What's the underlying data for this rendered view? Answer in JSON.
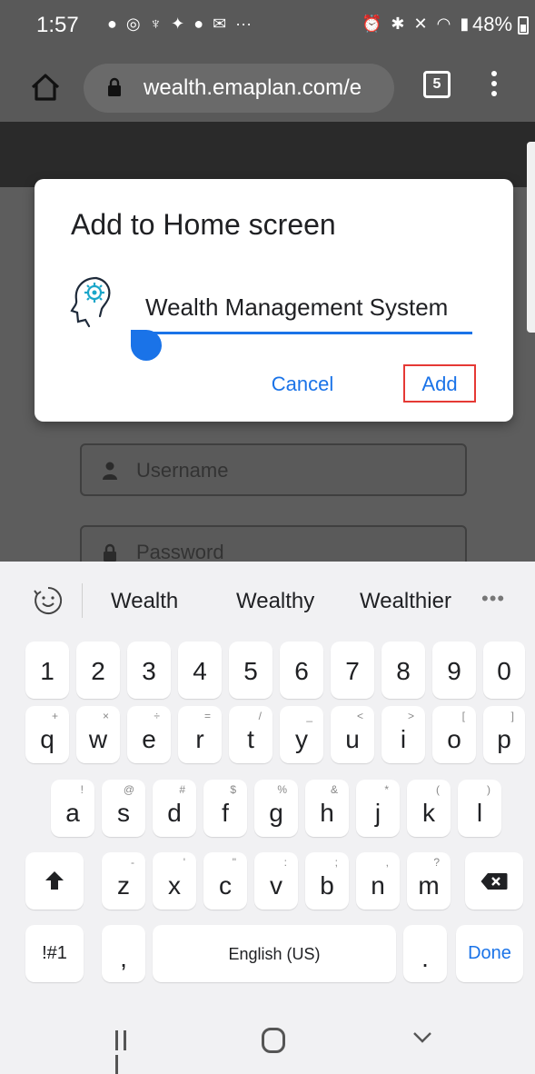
{
  "status_bar": {
    "time": "1:57",
    "battery": "48%",
    "notification_icons": [
      "spotify-icon",
      "instagram-icon",
      "app-icon",
      "app-icon",
      "facebook-icon",
      "gmail-icon",
      "more-icon"
    ],
    "system_icons": [
      "alarm-icon",
      "bluetooth-icon",
      "mute-icon",
      "wifi-icon",
      "signal-icon"
    ]
  },
  "browser": {
    "url": "wealth.emaplan.com/e",
    "tab_count": "5"
  },
  "page": {
    "username_placeholder": "Username",
    "password_placeholder": "Password"
  },
  "dialog": {
    "title": "Add to Home screen",
    "app_name": "Wealth Management System",
    "cancel_label": "Cancel",
    "add_label": "Add",
    "accent_color": "#1a73e8",
    "highlight_color": "#e53935"
  },
  "keyboard": {
    "suggestions": [
      "Wealth",
      "Wealthy",
      "Wealthier"
    ],
    "more_label": "•••",
    "number_row": [
      "1",
      "2",
      "3",
      "4",
      "5",
      "6",
      "7",
      "8",
      "9",
      "0"
    ],
    "row1": [
      {
        "k": "q",
        "s": "+"
      },
      {
        "k": "w",
        "s": "×"
      },
      {
        "k": "e",
        "s": "÷"
      },
      {
        "k": "r",
        "s": "="
      },
      {
        "k": "t",
        "s": "/"
      },
      {
        "k": "y",
        "s": "_"
      },
      {
        "k": "u",
        "s": "<"
      },
      {
        "k": "i",
        "s": ">"
      },
      {
        "k": "o",
        "s": "["
      },
      {
        "k": "p",
        "s": "]"
      }
    ],
    "row2": [
      {
        "k": "a",
        "s": "!"
      },
      {
        "k": "s",
        "s": "@"
      },
      {
        "k": "d",
        "s": "#"
      },
      {
        "k": "f",
        "s": "$"
      },
      {
        "k": "g",
        "s": "%"
      },
      {
        "k": "h",
        "s": "&"
      },
      {
        "k": "j",
        "s": "*"
      },
      {
        "k": "k",
        "s": "("
      },
      {
        "k": "l",
        "s": ")"
      }
    ],
    "row3": [
      {
        "k": "z",
        "s": "-"
      },
      {
        "k": "x",
        "s": "'"
      },
      {
        "k": "c",
        "s": "\""
      },
      {
        "k": "v",
        "s": ":"
      },
      {
        "k": "b",
        "s": ";"
      },
      {
        "k": "n",
        "s": ","
      },
      {
        "k": "m",
        "s": "?"
      }
    ],
    "symbols_label": "!#1",
    "comma_label": ",",
    "space_label": "English (US)",
    "period_label": ".",
    "done_label": "Done"
  }
}
